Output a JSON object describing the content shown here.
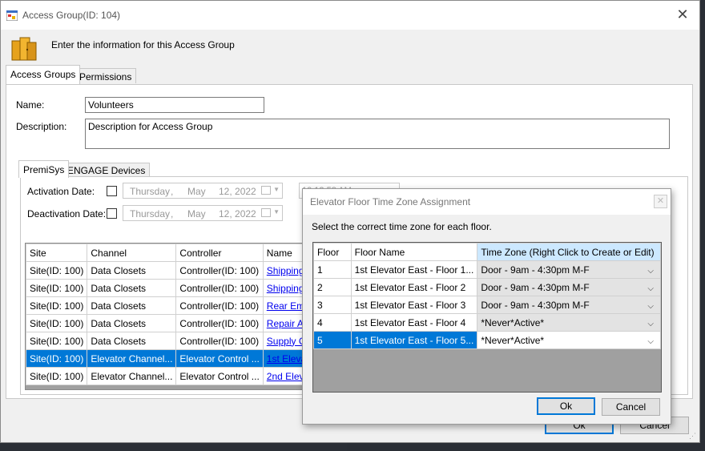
{
  "window": {
    "title": "Access Group(ID: 104)",
    "header_text": "Enter the information for this Access Group",
    "tabs": [
      "Access Groups",
      "Permissions"
    ]
  },
  "form": {
    "name_label": "Name:",
    "name_value": "Volunteers",
    "description_label": "Description:",
    "description_value": "Description for Access Group"
  },
  "inner_tabs": [
    "PremiSys",
    "ENGAGE Devices"
  ],
  "dates": {
    "activation_label": "Activation Date:",
    "deactivation_label": "Deactivation Date:",
    "weekday": "Thursday",
    "sep1": ",",
    "month": "May",
    "day_year": "12, 2022",
    "time": "10:12:58 AM"
  },
  "main_grid": {
    "headers": [
      "Site",
      "Channel",
      "Controller",
      "Name"
    ],
    "rows": [
      [
        "Site(ID: 100)",
        "Data Closets",
        "Controller(ID: 100)",
        "Shipping"
      ],
      [
        "Site(ID: 100)",
        "Data Closets",
        "Controller(ID: 100)",
        "Shipping"
      ],
      [
        "Site(ID: 100)",
        "Data Closets",
        "Controller(ID: 100)",
        "Rear Eme"
      ],
      [
        "Site(ID: 100)",
        "Data Closets",
        "Controller(ID: 100)",
        "Repair Ar"
      ],
      [
        "Site(ID: 100)",
        "Data Closets",
        "Controller(ID: 100)",
        "Supply C"
      ],
      [
        "Site(ID: 100)",
        "Elevator Channel...",
        "Elevator Control ...",
        "1st Eleva"
      ],
      [
        "Site(ID: 100)",
        "Elevator Channel...",
        "Elevator Control ...",
        "2nd Elev"
      ]
    ],
    "selected_index": 5
  },
  "main_buttons": {
    "ok": "Ok",
    "cancel": "Cancel"
  },
  "dialog": {
    "title": "Elevator Floor Time Zone Assignment",
    "instruction": "Select the correct time zone for each floor.",
    "headers": [
      "Floor",
      "Floor Name",
      "Time Zone (Right Click to Create or Edit)"
    ],
    "rows": [
      [
        "1",
        "1st Elevator East - Floor 1...",
        "Door - 9am - 4:30pm M-F"
      ],
      [
        "2",
        "1st Elevator East - Floor 2",
        "Door - 9am - 4:30pm M-F"
      ],
      [
        "3",
        "1st Elevator East - Floor 3",
        "Door - 9am - 4:30pm M-F"
      ],
      [
        "4",
        "1st Elevator East - Floor 4",
        "*Never*Active*"
      ],
      [
        "5",
        "1st Elevator East - Floor 5...",
        "*Never*Active*"
      ]
    ],
    "selected_index": 4,
    "ok": "Ok",
    "cancel": "Cancel"
  },
  "colors": {
    "selection": "#0078d7",
    "link": "#0000ee",
    "header_highlight": "#cce8ff"
  }
}
